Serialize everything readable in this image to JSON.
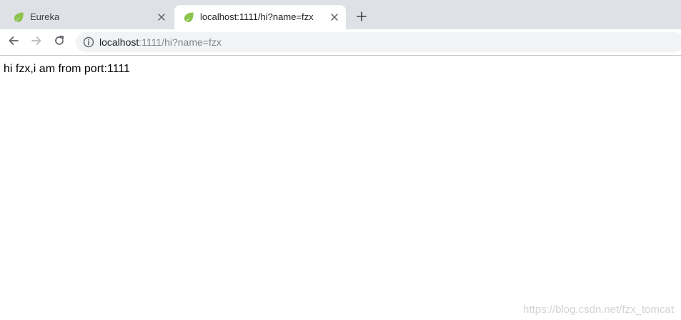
{
  "tabs": [
    {
      "title": "Eureka",
      "active": false,
      "favicon": "spring-leaf-icon"
    },
    {
      "title": "localhost:1111/hi?name=fzx",
      "active": true,
      "favicon": "spring-leaf-icon"
    }
  ],
  "toolbar": {
    "back_icon": "arrow-left-icon",
    "forward_icon": "arrow-right-icon",
    "reload_icon": "reload-icon",
    "new_tab_icon": "plus-icon"
  },
  "address_bar": {
    "host": "localhost",
    "rest": ":1111/hi?name=fzx",
    "security_icon": "info-circle-icon"
  },
  "page": {
    "body_text": "hi fzx,i am from port:1111"
  },
  "watermark": "https://blog.csdn.net/fzx_tomcat",
  "colors": {
    "tab_strip": "#dee1e6",
    "omnibox": "#f1f3f4",
    "leaf_green": "#8bc34a"
  }
}
